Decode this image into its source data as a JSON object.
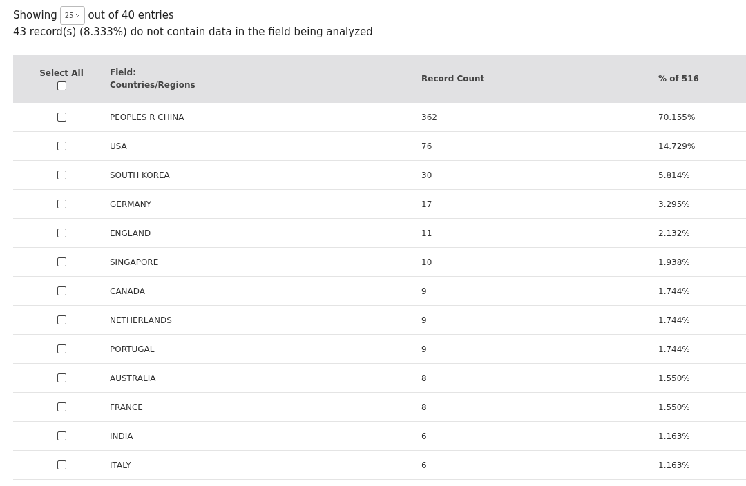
{
  "paging": {
    "prefix": "Showing",
    "page_size": "25",
    "suffix": "out of 40 entries"
  },
  "note": "43 record(s) (8.333%) do not contain data in the field being analyzed",
  "table": {
    "select_all": {
      "label": "Select All",
      "checked": false
    },
    "columns": [
      "Field:\nCountries/Regions",
      "Record Count",
      "% of 516"
    ],
    "rows": [
      {
        "checked": false,
        "field": "PEOPLES R CHINA",
        "count": "362",
        "percent": "70.155%"
      },
      {
        "checked": false,
        "field": "USA",
        "count": "76",
        "percent": "14.729%"
      },
      {
        "checked": false,
        "field": "SOUTH KOREA",
        "count": "30",
        "percent": "5.814%"
      },
      {
        "checked": false,
        "field": "GERMANY",
        "count": "17",
        "percent": "3.295%"
      },
      {
        "checked": false,
        "field": "ENGLAND",
        "count": "11",
        "percent": "2.132%"
      },
      {
        "checked": false,
        "field": "SINGAPORE",
        "count": "10",
        "percent": "1.938%"
      },
      {
        "checked": false,
        "field": "CANADA",
        "count": "9",
        "percent": "1.744%"
      },
      {
        "checked": false,
        "field": "NETHERLANDS",
        "count": "9",
        "percent": "1.744%"
      },
      {
        "checked": false,
        "field": "PORTUGAL",
        "count": "9",
        "percent": "1.744%"
      },
      {
        "checked": false,
        "field": "AUSTRALIA",
        "count": "8",
        "percent": "1.550%"
      },
      {
        "checked": false,
        "field": "FRANCE",
        "count": "8",
        "percent": "1.550%"
      },
      {
        "checked": false,
        "field": "INDIA",
        "count": "6",
        "percent": "1.163%"
      },
      {
        "checked": false,
        "field": "ITALY",
        "count": "6",
        "percent": "1.163%"
      }
    ]
  }
}
